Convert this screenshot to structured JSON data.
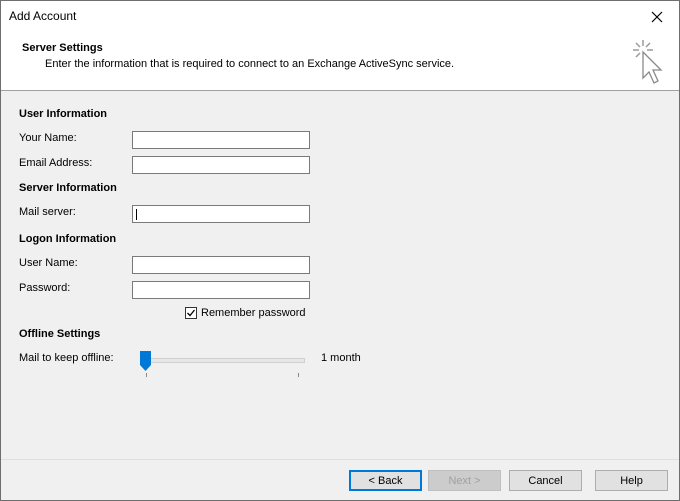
{
  "window": {
    "title": "Add Account"
  },
  "header": {
    "title": "Server Settings",
    "subtitle": "Enter the information that is required to connect to an Exchange ActiveSync service."
  },
  "user_info": {
    "section": "User Information",
    "name_label": "Your Name:",
    "name_value": "",
    "email_label": "Email Address:",
    "email_value": ""
  },
  "server_info": {
    "section": "Server Information",
    "mail_server_label": "Mail server:",
    "mail_server_value": ""
  },
  "logon_info": {
    "section": "Logon Information",
    "username_label": "User Name:",
    "username_value": "",
    "password_label": "Password:",
    "password_value": "",
    "remember_label": "Remember password",
    "remember_checked": true
  },
  "offline": {
    "section": "Offline Settings",
    "label": "Mail to keep offline:",
    "value_text": "1 month",
    "slider_fraction": 0.0
  },
  "buttons": {
    "back": "< Back",
    "next": "Next >",
    "cancel": "Cancel",
    "help": "Help"
  },
  "colors": {
    "accent": "#0078d7"
  },
  "icons": {
    "close": "close-icon",
    "header": "cursor-click-icon",
    "check": "checkmark-icon",
    "slider": "slider-thumb-icon"
  }
}
